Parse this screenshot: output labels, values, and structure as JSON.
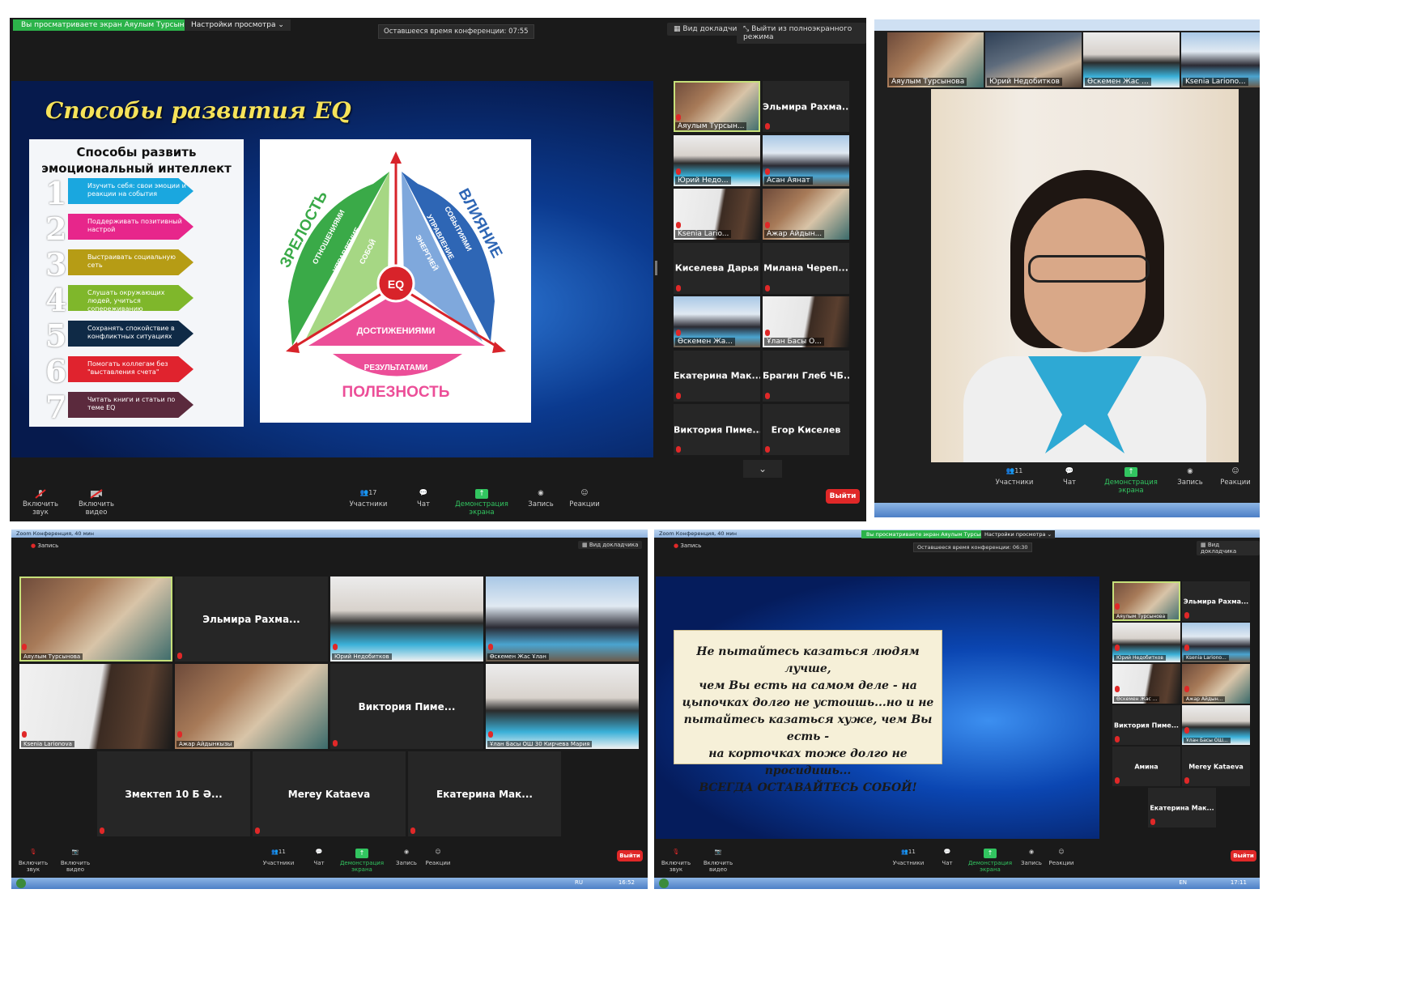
{
  "p1": {
    "share_banner": "Вы просматриваете экран Аяулым Турсынова",
    "view_settings": "Настройки просмотра",
    "time_left": "Оставшееся время конференции: 07:55",
    "speaker_view": "Вид докладчика",
    "exit_fullscreen": "Выйти из полноэкранного режима",
    "slide": {
      "title": "Способы развития  EQ",
      "list_head": "Способы развить эмоциональный интеллект",
      "items": [
        {
          "n": "1",
          "text": "Изучить себя: свои эмоции и реакции на события",
          "color": "#1aa7df"
        },
        {
          "n": "2",
          "text": "Поддерживать позитивный настрой",
          "color": "#e7268b"
        },
        {
          "n": "3",
          "text": "Выстраивать социальную сеть",
          "color": "#b69c15"
        },
        {
          "n": "4",
          "text": "Слушать окружающих людей, учиться сопереживанию",
          "color": "#7fb72b"
        },
        {
          "n": "5",
          "text": "Сохранять спокойствие в конфликтных ситуациях",
          "color": "#0f2a46"
        },
        {
          "n": "6",
          "text": "Помогать коллегам без \"выставления счета\"",
          "color": "#e0232e"
        },
        {
          "n": "7",
          "text": "Читать книги и статьи по теме EQ",
          "color": "#5b2a3d"
        }
      ],
      "diagram": {
        "zrelost": "ЗРЕЛОСТЬ",
        "vliyanie": "ВЛИЯНИЕ",
        "poleznost": "ПОЛЕЗНОСТЬ",
        "eq": "EQ",
        "left_a": "ОТНОШЕНИЯМИ",
        "left_b": "УПРАВЛЕНИЕ",
        "left_c": "СОБОЙ",
        "right_a": "СОБЫТИЯМИ",
        "right_b": "УПРАВЛЕНИЕ",
        "right_c": "ЭНЕРГИЕЙ",
        "bottom_a": "ДОСТИЖЕНИЯМИ",
        "bottom_b": "УПРАВЛЕНИЕ",
        "bottom_c": "РЕЗУЛЬТАТАМИ"
      }
    },
    "tiles": [
      {
        "label": "Аяулым Турсын...",
        "video": true
      },
      {
        "name": "Эльмира  Рахма..."
      },
      {
        "label": "Юрий Недо...",
        "video": true
      },
      {
        "label": "Асан Аянат",
        "video": true
      },
      {
        "label": "Ksenia Lario...",
        "video": true
      },
      {
        "label": "Ажар Айдын...",
        "video": true
      },
      {
        "name": "Киселева Дарья"
      },
      {
        "name": "Милана  Череп..."
      },
      {
        "label": "Өскемен Жа...",
        "video": true
      },
      {
        "label": "Ұлан Басы О...",
        "video": true
      },
      {
        "name": "Екатерина  Мак..."
      },
      {
        "name": "Брагин Глеб ЧБ..."
      },
      {
        "name": "Виктория  Пиме..."
      },
      {
        "name": "Егор Киселев"
      }
    ],
    "toolbar": {
      "audio": "Включить звук",
      "video": "Включить видео",
      "participants": "Участники",
      "participants_count": "17",
      "chat": "Чат",
      "share": "Демонстрация экрана",
      "record": "Запись",
      "reactions": "Реакции",
      "exit": "Выйти"
    }
  },
  "p2": {
    "strip": [
      "Аяулым Турсынова",
      "Юрий Недобитков",
      "Өскемен Жас ...",
      "Ksenia Lariono..."
    ],
    "toolbar": {
      "participants": "Участники",
      "participants_count": "11",
      "chat": "Чат",
      "share": "Демонстрация экрана",
      "record": "Запись",
      "reactions": "Реакции"
    }
  },
  "p3": {
    "window_title": "Zoom Конференция, 40 мин",
    "record": "Запись",
    "speaker_view": "Вид докладчика",
    "tiles": [
      {
        "label": "Аяулым Турсынова",
        "video": true
      },
      {
        "name": "Эльмира  Рахма..."
      },
      {
        "label": "Юрий Недобитков",
        "video": true
      },
      {
        "label": "Өскемен Жас Ұлан",
        "video": true
      },
      {
        "label": "Ksenia Larionova",
        "video": true
      },
      {
        "label": "Ажар Айдынкызы",
        "video": true
      },
      {
        "name": "Виктория  Пиме..."
      },
      {
        "label": "Ұлан Басы ОШ 30 Кирчева Мария",
        "video": true
      },
      {
        "name": "Змектеп 10 Б  Ә..."
      },
      {
        "name": "Merey Kataeva"
      },
      {
        "name": "Екатерина  Мак..."
      }
    ],
    "toolbar": {
      "audio": "Включить звук",
      "video": "Включить видео",
      "participants": "Участники",
      "participants_count": "11",
      "chat": "Чат",
      "share": "Демонстрация экрана",
      "record": "Запись",
      "reactions": "Реакции",
      "exit": "Выйти"
    },
    "clock": "16:52",
    "lang": "RU"
  },
  "p4": {
    "window_title": "Zoom Конференция, 40 мин",
    "share_banner": "Вы просматриваете экран Аяулым Турсынова",
    "view_settings": "Настройки просмотра",
    "record": "Запись",
    "time_left": "Оставшееся время конференции: 06:30",
    "speaker_view": "Вид докладчика",
    "quote": [
      "Не пытайтесь казаться людям лучше,",
      "чем Вы есть на самом деле - на",
      "цыпочках долго не устоишь...но и не",
      "пытайтесь казаться хуже, чем Вы есть -",
      "на корточках тоже долго не",
      "просидишь...",
      "ВСЕГДА ОСТАВАЙТЕСЬ СОБОЙ!"
    ],
    "tiles": [
      {
        "label": "Аяулым Турсынова",
        "video": true
      },
      {
        "name": "Эльмира  Рахма..."
      },
      {
        "label": "Юрий Недобитков",
        "video": true
      },
      {
        "label": "Ksenia Lariono...",
        "video": true
      },
      {
        "label": "Өскемен Жас ...",
        "video": true
      },
      {
        "label": "Ажар Айдын...",
        "video": true
      },
      {
        "name": "Виктория  Пиме..."
      },
      {
        "label": "Ұлан Басы ОШ...",
        "video": true
      },
      {
        "name": "Амина"
      },
      {
        "name": "Merey Kataeva"
      },
      {
        "name": "Екатерина  Мак..."
      }
    ],
    "toolbar": {
      "audio": "Включить звук",
      "video": "Включить видео",
      "participants": "Участники",
      "participants_count": "11",
      "chat": "Чат",
      "share": "Демонстрация экрана",
      "record": "Запись",
      "reactions": "Реакции",
      "exit": "Выйти"
    },
    "clock": "17:11",
    "lang": "EN"
  }
}
